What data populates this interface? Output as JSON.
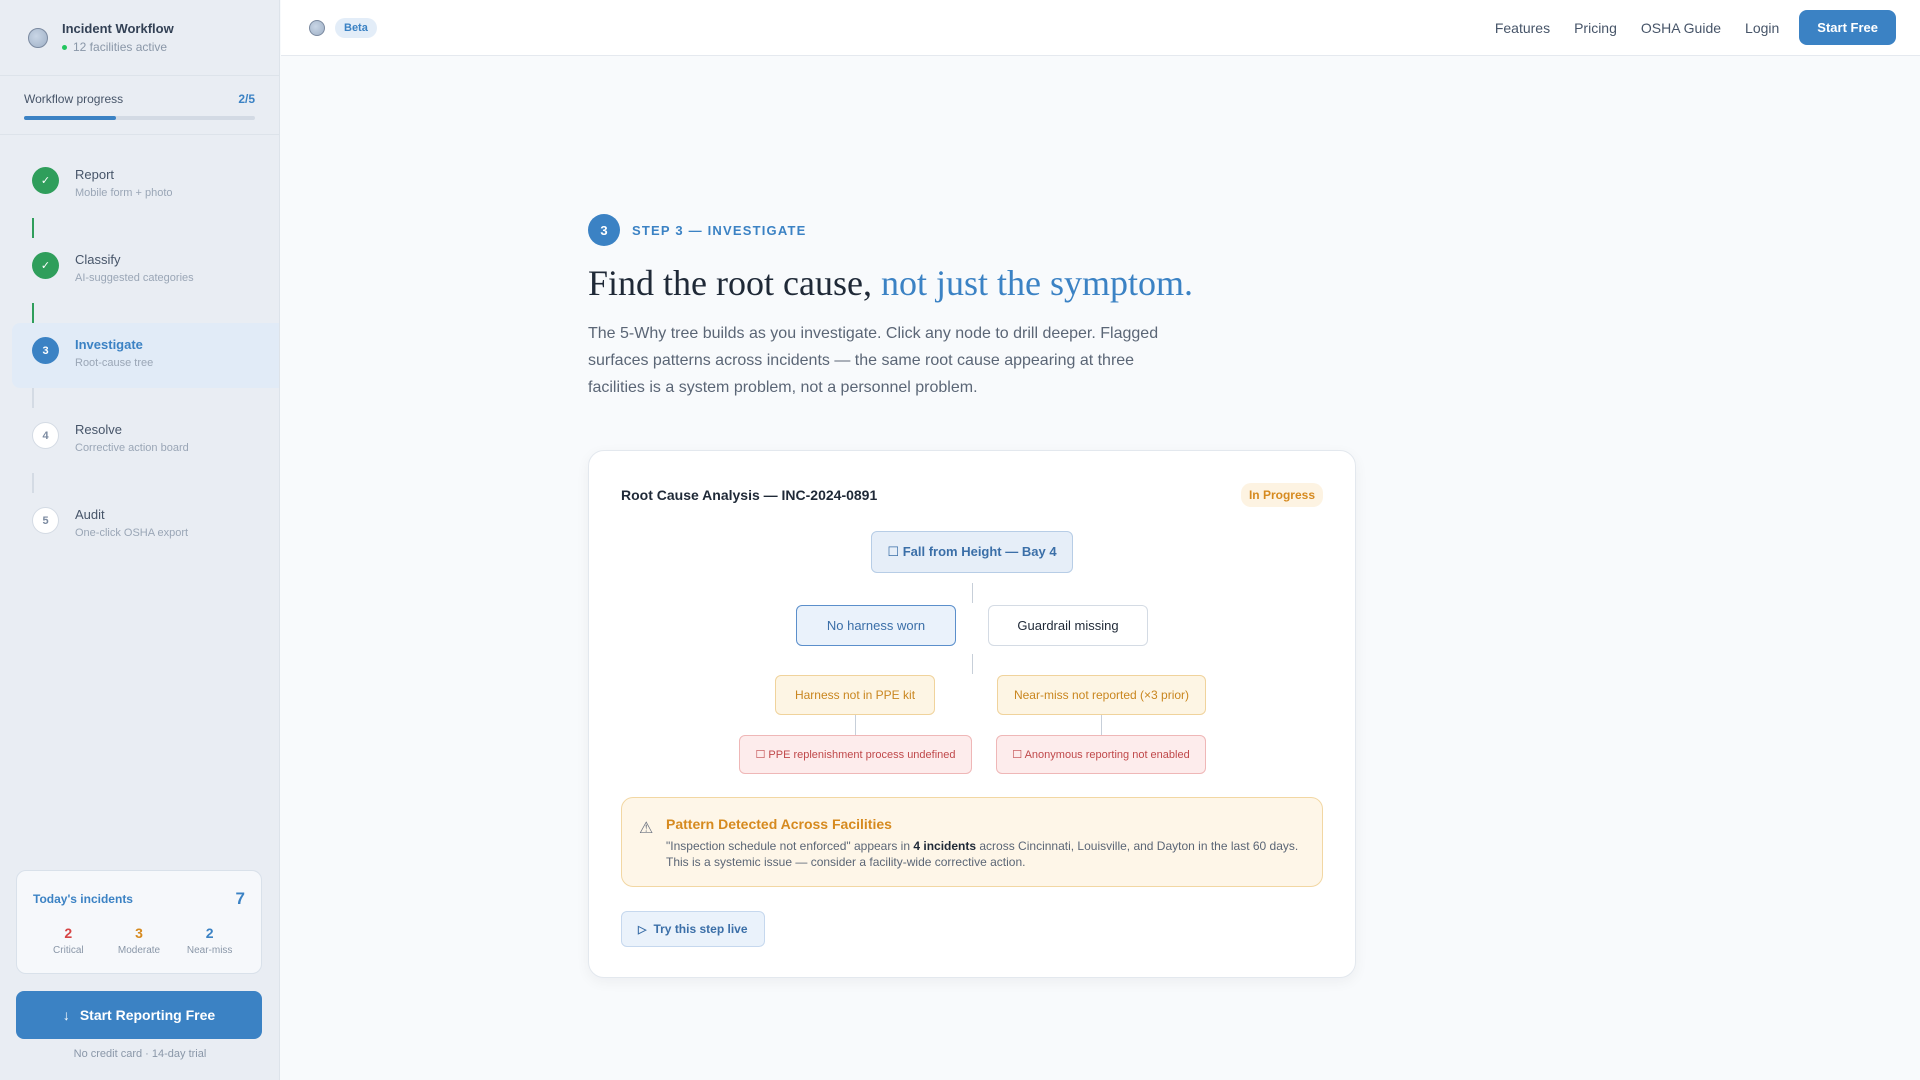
{
  "sidebar": {
    "title": "Incident Workflow",
    "subtitle": "12 facilities active",
    "progress": {
      "label": "Workflow progress",
      "count": "2/5",
      "fraction": 0.4
    },
    "steps": [
      {
        "num": "1",
        "label": "Report",
        "desc": "Mobile form + photo",
        "state": "done"
      },
      {
        "num": "2",
        "label": "Classify",
        "desc": "AI-suggested categories",
        "state": "done"
      },
      {
        "num": "3",
        "label": "Investigate",
        "desc": "Root-cause tree",
        "state": "active"
      },
      {
        "num": "4",
        "label": "Resolve",
        "desc": "Corrective action board",
        "state": "todo"
      },
      {
        "num": "5",
        "label": "Audit",
        "desc": "One-click OSHA export",
        "state": "todo"
      }
    ],
    "incidents": {
      "title": "Today's incidents",
      "total": "7",
      "critical": {
        "value": "2",
        "label": "Critical",
        "color": "#d64545"
      },
      "moderate": {
        "value": "3",
        "label": "Moderate",
        "color": "#d68a1f"
      },
      "nearmiss": {
        "value": "2",
        "label": "Near-miss",
        "color": "#3b82c4"
      }
    },
    "cta": "Start Reporting Free",
    "trial": "No credit card · 14-day trial"
  },
  "topnav": {
    "badge": "Beta",
    "links": [
      "Features",
      "Pricing",
      "OSHA Guide",
      "Login"
    ],
    "cta": "Start Free"
  },
  "main": {
    "step_num": "3",
    "eyebrow": "STEP 3 — INVESTIGATE",
    "headline": "Find the root cause,",
    "headline_accent": "not just the symptom.",
    "lede": "The 5-Why tree builds as you investigate. Click any node to drill deeper. Flagged surfaces patterns across incidents — the same root cause appearing at three facilities is a system problem, not a personnel problem.",
    "card": {
      "title": "Root Cause Analysis — INC-2024-0891",
      "status": "In Progress",
      "tree": {
        "root": "☐ Fall from Height — Bay 4",
        "why1_a": "No harness worn",
        "why1_b": "Guardrail missing",
        "why2_a": "Harness not in PPE kit",
        "why2_b": "Near-miss not reported (×3 prior)",
        "root_a": "☐ PPE replenishment process undefined",
        "root_b": "☐ Anonymous reporting not enabled"
      },
      "alert": {
        "icon": "warning-icon",
        "title": "Pattern Detected Across Facilities",
        "text_pre": "\"Inspection schedule not enforced\" appears in ",
        "text_bold": "4 incidents",
        "text_post": " across Cincinnati, Louisville, and Dayton in the last 60 days. This is a systemic issue — consider a facility-wide corrective action."
      },
      "try_button": "Try this step live"
    }
  }
}
